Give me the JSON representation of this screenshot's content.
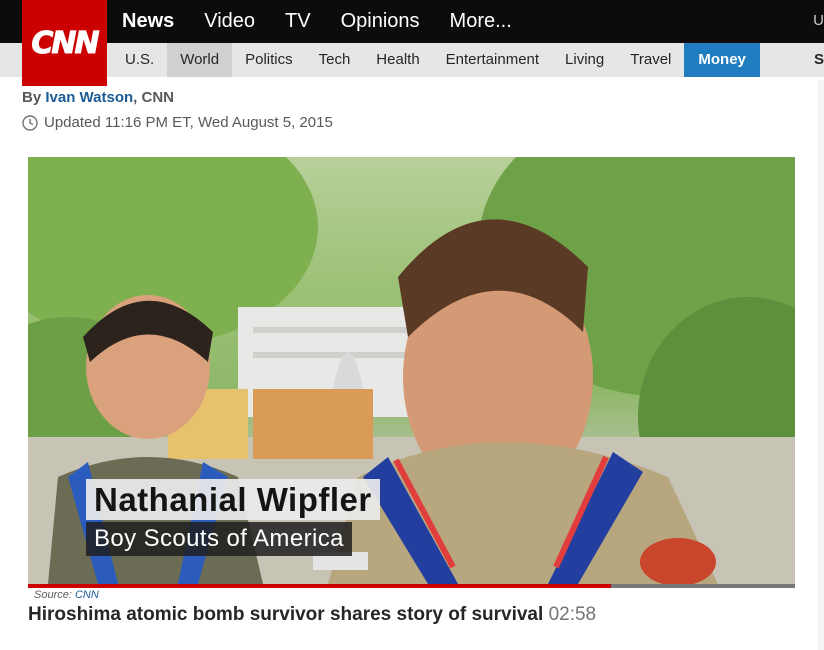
{
  "brand": {
    "logo_text": "CNN",
    "color": "#cc0000"
  },
  "primary_nav": [
    "News",
    "Video",
    "TV",
    "Opinions",
    "More..."
  ],
  "primary_nav_edge": "U",
  "section_nav": [
    "U.S.",
    "World",
    "Politics",
    "Tech",
    "Health",
    "Entertainment",
    "Living",
    "Travel",
    "Money"
  ],
  "section_nav_edge": "S",
  "article": {
    "byline_prefix": "By",
    "author": "Ivan Watson",
    "byline_suffix": ", CNN",
    "updated": "Updated 11:16 PM ET, Wed August 5, 2015"
  },
  "video": {
    "lower_third_name": "Nathanial Wipfler",
    "lower_third_title": "Boy Scouts of America",
    "progress": 0.76,
    "source_label": "Source:",
    "source_value": "CNN",
    "caption": "Hiroshima atomic bomb survivor shares story of survival",
    "duration": "02:58"
  },
  "colors": {
    "accent_money": "#1f7dc0",
    "link": "#1b5c96"
  }
}
